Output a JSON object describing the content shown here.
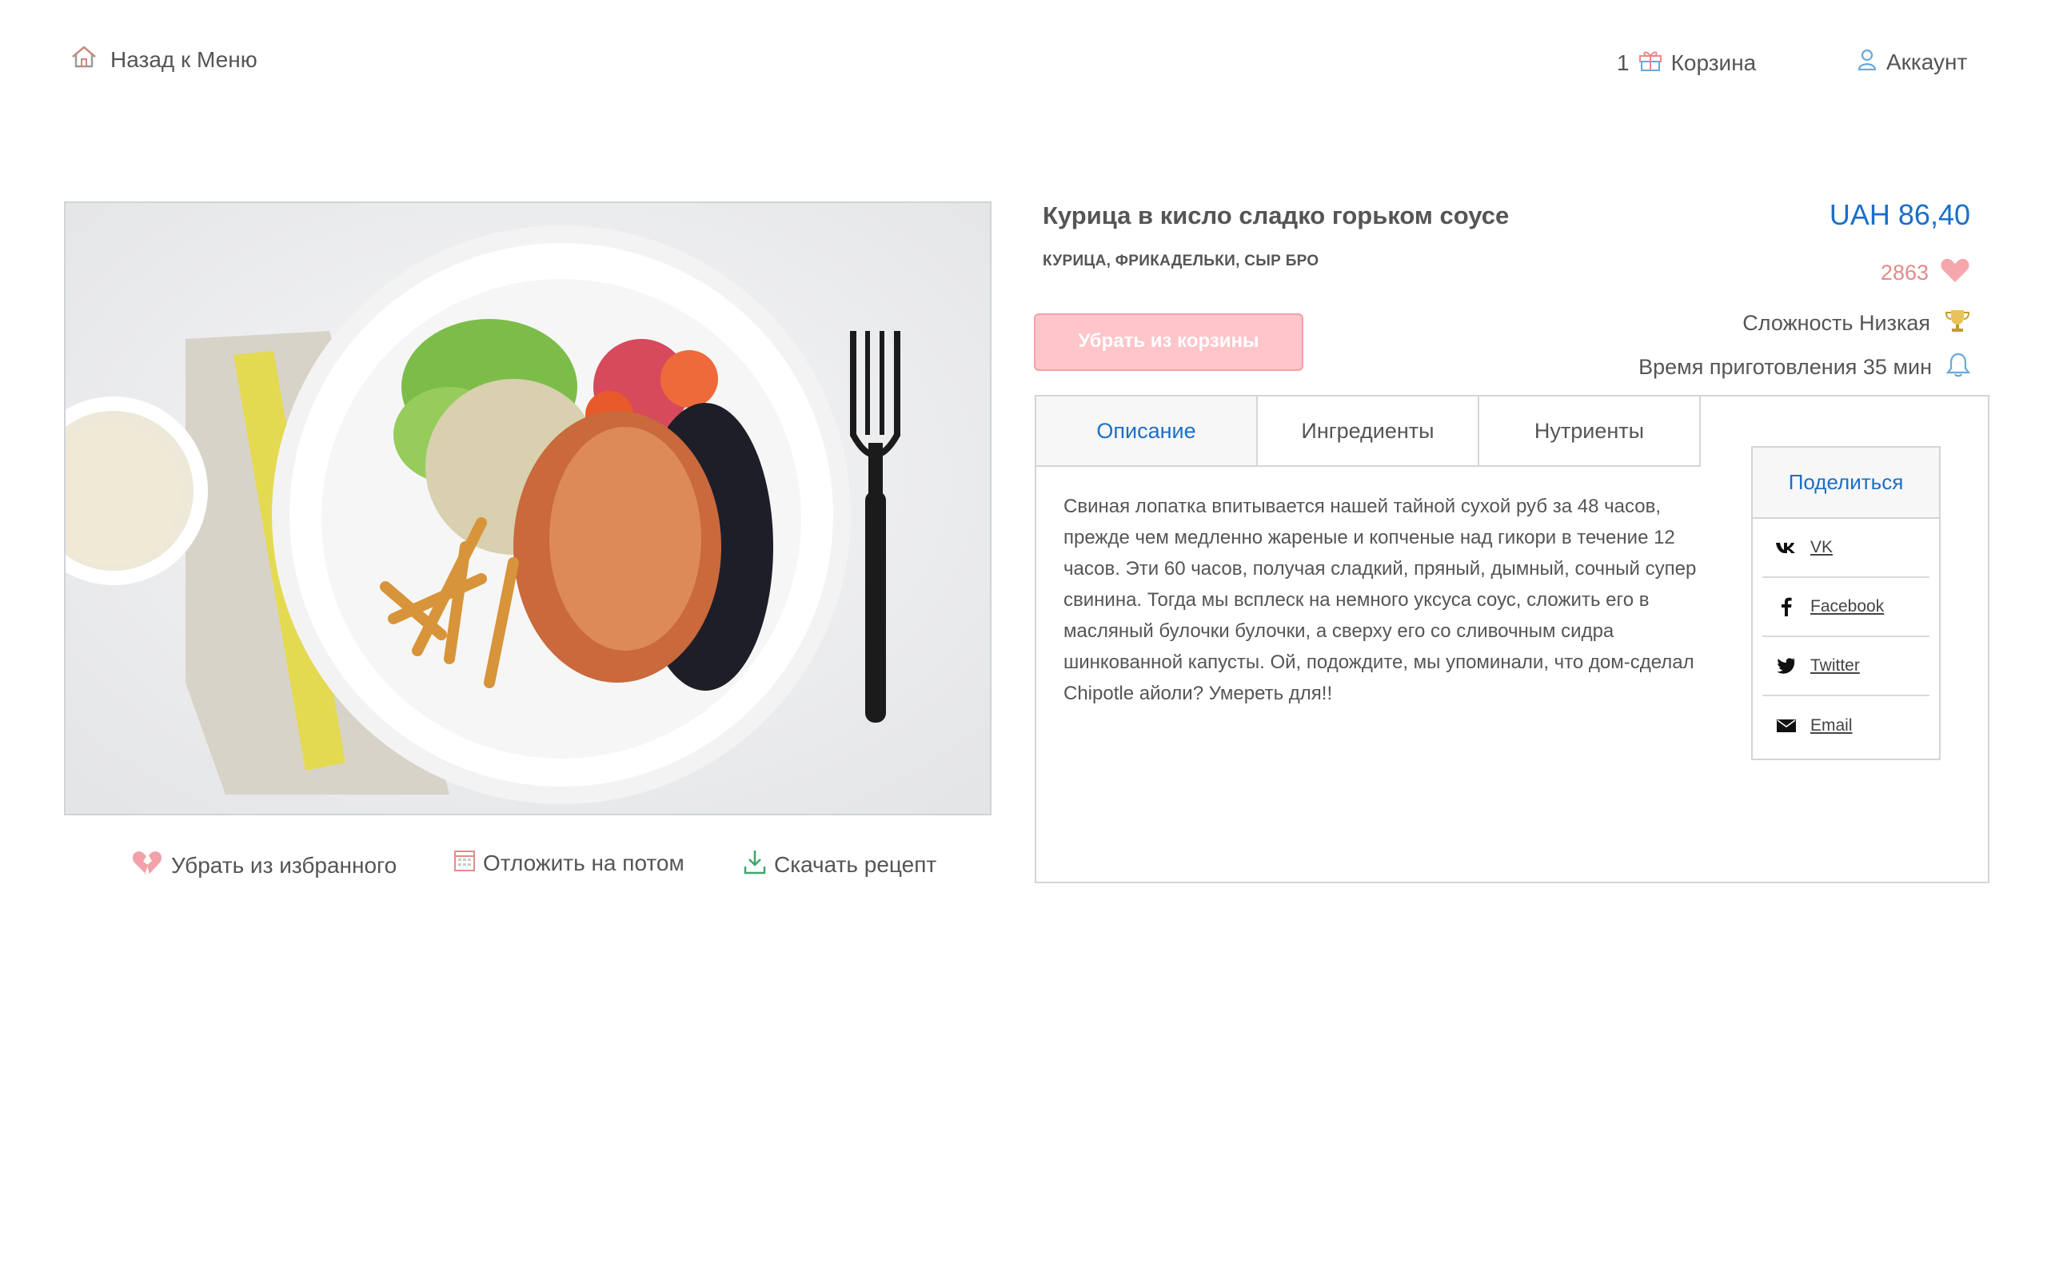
{
  "header": {
    "back_label": "Назад к Меню",
    "cart_count": "1",
    "cart_label": "Корзина",
    "account_label": "Аккаунт"
  },
  "dish": {
    "title": "Курица в кисло сладко горьком соусе",
    "tags": "КУРИЦА, ФРИКАДЕЛЬКИ, СЫР БРО",
    "price": "UAH 86,40",
    "likes": "2863",
    "difficulty": "Сложность Низкая",
    "cook_time": "Время приготовления 35 мин",
    "remove_cart_label": "Убрать из корзины"
  },
  "actions": {
    "unfavorite": "Убрать из избранного",
    "later": "Отложить на потом",
    "download": "Скачать рецепт"
  },
  "tabs": [
    {
      "label": "Описание",
      "active": true
    },
    {
      "label": "Ингредиенты",
      "active": false
    },
    {
      "label": "Нутриенты",
      "active": false
    }
  ],
  "description": "Свиная лопатка впитывается нашей тайной сухой руб за 48 часов, прежде чем медленно жареные и копченые над гикори в течение 12 часов. Эти 60 часов, получая сладкий, пряный, дымный, сочный супер свинина. Тогда мы всплеск на немного уксуса соус, сложить его в масляный булочки булочки, а сверху его со сливочным сидра шинкованной капусты. Ой, подождите, мы упоминали, что дом-сделал Chipotle айоли? Умереть для!!",
  "share": {
    "title": "Поделиться",
    "items": [
      {
        "label": "VK",
        "icon": "vk-icon"
      },
      {
        "label": "Facebook",
        "icon": "facebook-icon"
      },
      {
        "label": "Twitter",
        "icon": "twitter-icon"
      },
      {
        "label": "Email",
        "icon": "email-icon"
      }
    ]
  },
  "colors": {
    "accent": "#1a6fc9",
    "like": "#e58a8a",
    "button_bg": "#ffc5c9"
  }
}
